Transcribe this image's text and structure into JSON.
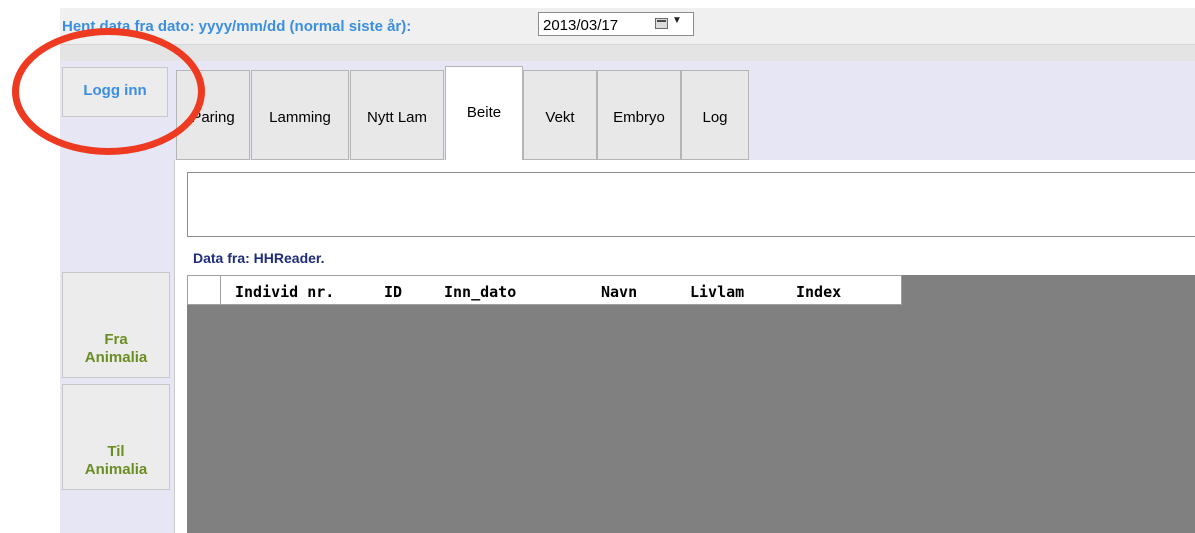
{
  "header": {
    "date_label": "Hent data fra dato: yyyy/mm/dd (normal siste år):",
    "date_value": "2013/03/17"
  },
  "sidebar": {
    "login_label": "Logg inn",
    "fra_line1": "Fra",
    "fra_line2": "Animalia",
    "til_line1": "Til",
    "til_line2": "Animalia"
  },
  "tabs": [
    {
      "label": "Paring"
    },
    {
      "label": "Lamming"
    },
    {
      "label": "Nytt Lam"
    },
    {
      "label": "Beite",
      "active": true
    },
    {
      "label": "Vekt"
    },
    {
      "label": "Embryo"
    },
    {
      "label": "Log"
    }
  ],
  "main": {
    "data_source_label": "Data fra: HHReader.",
    "columns": [
      "Individ nr.",
      "ID",
      "Inn_dato",
      "Navn",
      "Livlam",
      "Index"
    ]
  },
  "colors": {
    "accent": "#3b8fe0",
    "green_text": "#6b8e23",
    "annotation": "#ee3a20",
    "grid_bg": "#808080"
  }
}
